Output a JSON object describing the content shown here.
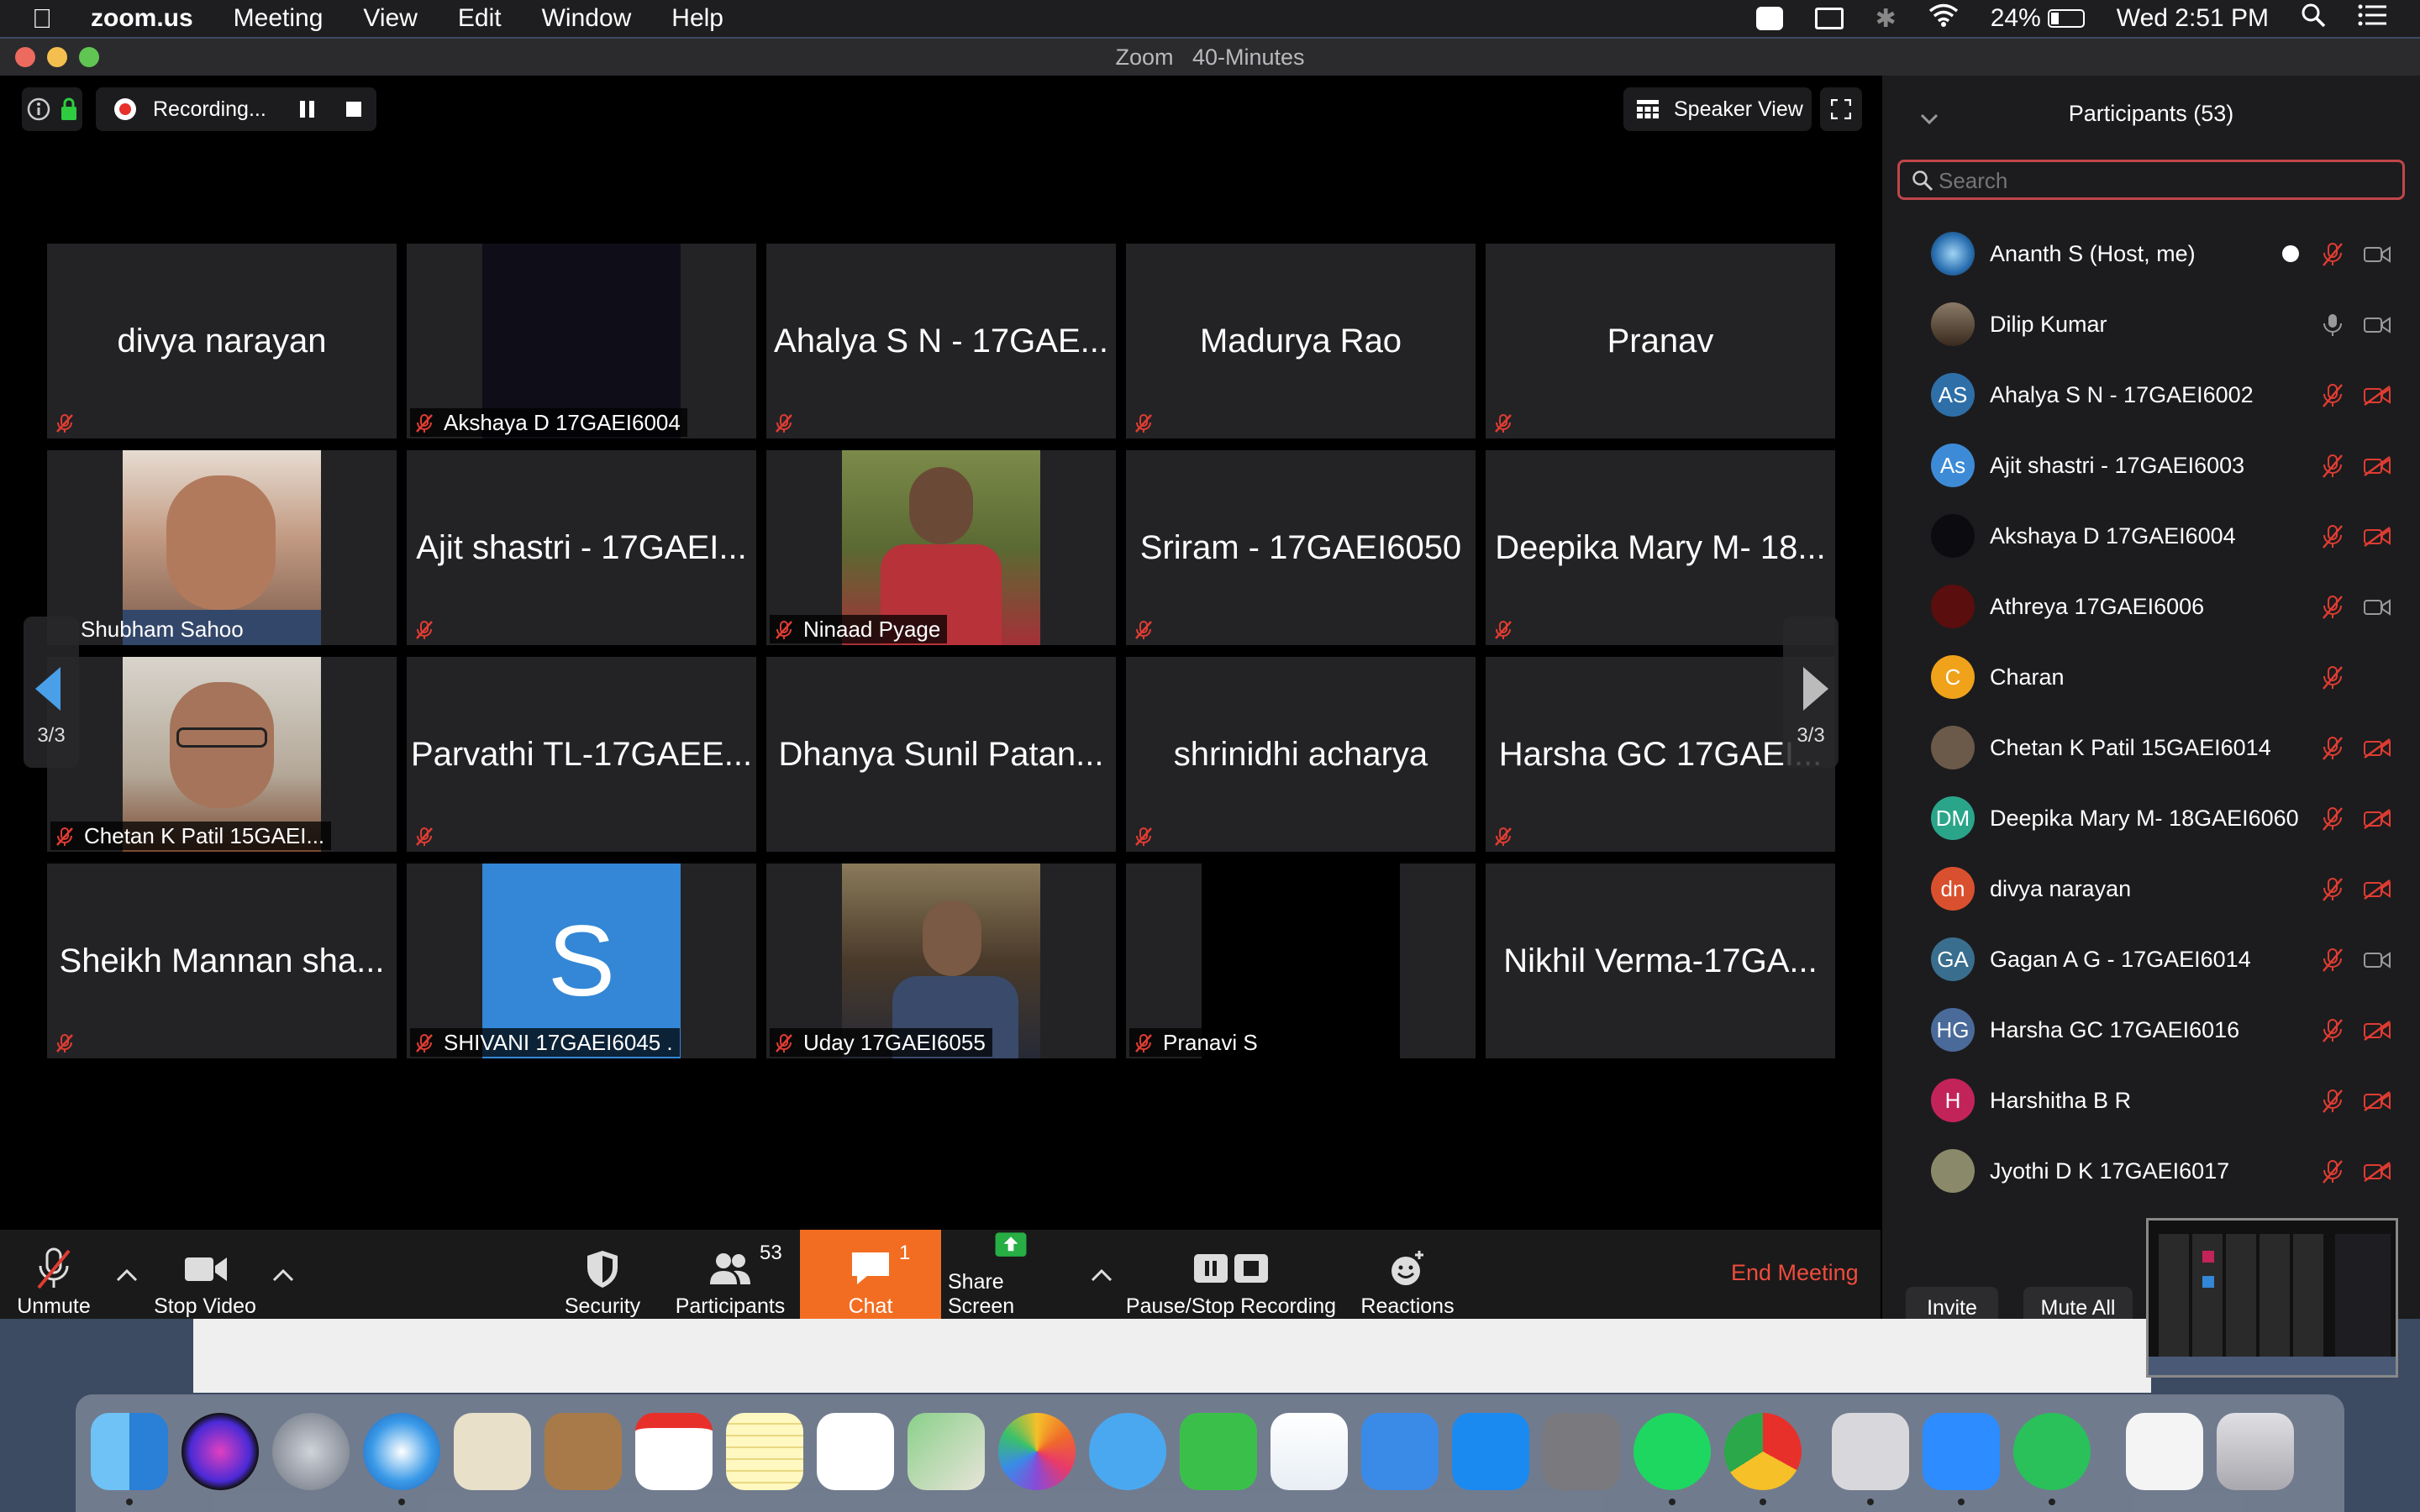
{
  "menubar": {
    "app": "zoom.us",
    "menus": [
      "Meeting",
      "View",
      "Edit",
      "Window",
      "Help"
    ],
    "battery": "24%",
    "clock": "Wed 2:51 PM"
  },
  "window": {
    "title": "Zoom   40-Minutes"
  },
  "topbar": {
    "recording_label": "Recording...",
    "speaker_view": "Speaker View"
  },
  "pager": {
    "left": "3/3",
    "right": "3/3"
  },
  "tiles": [
    {
      "name": "divya narayan"
    },
    {
      "name": "",
      "label": "Akshaya D 17GAEI6004"
    },
    {
      "name": "Ahalya S N - 17GAE..."
    },
    {
      "name": "Madurya Rao"
    },
    {
      "name": "Pranav"
    },
    {
      "name": "",
      "label": "Shubham Sahoo"
    },
    {
      "name": "Ajit shastri - 17GAEI..."
    },
    {
      "name": "",
      "label": "Ninaad Pyage"
    },
    {
      "name": "Sriram - 17GAEI6050"
    },
    {
      "name": "Deepika Mary M- 18..."
    },
    {
      "name": "",
      "label": "Chetan K Patil 15GAEI..."
    },
    {
      "name": "Parvathi TL-17GAEE..."
    },
    {
      "name": "Dhanya Sunil Patan..."
    },
    {
      "name": "shrinidhi acharya"
    },
    {
      "name": "Harsha GC 17GAEI..."
    },
    {
      "name": "Sheikh Mannan sha..."
    },
    {
      "name": "S",
      "label": "SHIVANI 17GAEI6045 ."
    },
    {
      "name": "",
      "label": "Uday 17GAEI6055"
    },
    {
      "name": "",
      "label": "Pranavi S"
    },
    {
      "name": "Nikhil Verma-17GA..."
    }
  ],
  "toolbar": {
    "unmute": "Unmute",
    "stop_video": "Stop Video",
    "security": "Security",
    "participants": "Participants",
    "participants_count": "53",
    "chat": "Chat",
    "chat_badge": "1",
    "share_screen": "Share Screen",
    "pause_stop_recording": "Pause/Stop Recording",
    "reactions": "Reactions",
    "end_meeting": "End Meeting"
  },
  "panel": {
    "title": "Participants (53)",
    "search_placeholder": "Search",
    "invite": "Invite",
    "mute_all": "Mute All",
    "participants": [
      {
        "name": "Ananth S (Host, me)",
        "initials": "",
        "color": "#2a6fb0"
      },
      {
        "name": "Dilip Kumar",
        "initials": "",
        "color": "#5a4a3a"
      },
      {
        "name": "Ahalya S N - 17GAEI6002",
        "initials": "AS",
        "color": "#2e6fa8"
      },
      {
        "name": "Ajit shastri - 17GAEI6003",
        "initials": "As",
        "color": "#3d8bd6"
      },
      {
        "name": "Akshaya D 17GAEI6004",
        "initials": "",
        "color": "#0b0b10"
      },
      {
        "name": "Athreya 17GAEI6006",
        "initials": "",
        "color": "#5a0e0e"
      },
      {
        "name": "Charan",
        "initials": "C",
        "color": "#f0a21a"
      },
      {
        "name": "Chetan K Patil 15GAEI6014",
        "initials": "",
        "color": "#6b5a4a"
      },
      {
        "name": "Deepika Mary M- 18GAEI6060",
        "initials": "DM",
        "color": "#2aa58a"
      },
      {
        "name": "divya narayan",
        "initials": "dn",
        "color": "#d9502e"
      },
      {
        "name": "Gagan A G - 17GAEI6014",
        "initials": "GA",
        "color": "#3a6e8e"
      },
      {
        "name": "Harsha GC 17GAEI6016",
        "initials": "HG",
        "color": "#4a6a9a"
      },
      {
        "name": "Harshitha B R",
        "initials": "H",
        "color": "#c2245a"
      },
      {
        "name": "Jyothi D K  17GAEI6017",
        "initials": "",
        "color": "#8a8a6a"
      }
    ]
  }
}
